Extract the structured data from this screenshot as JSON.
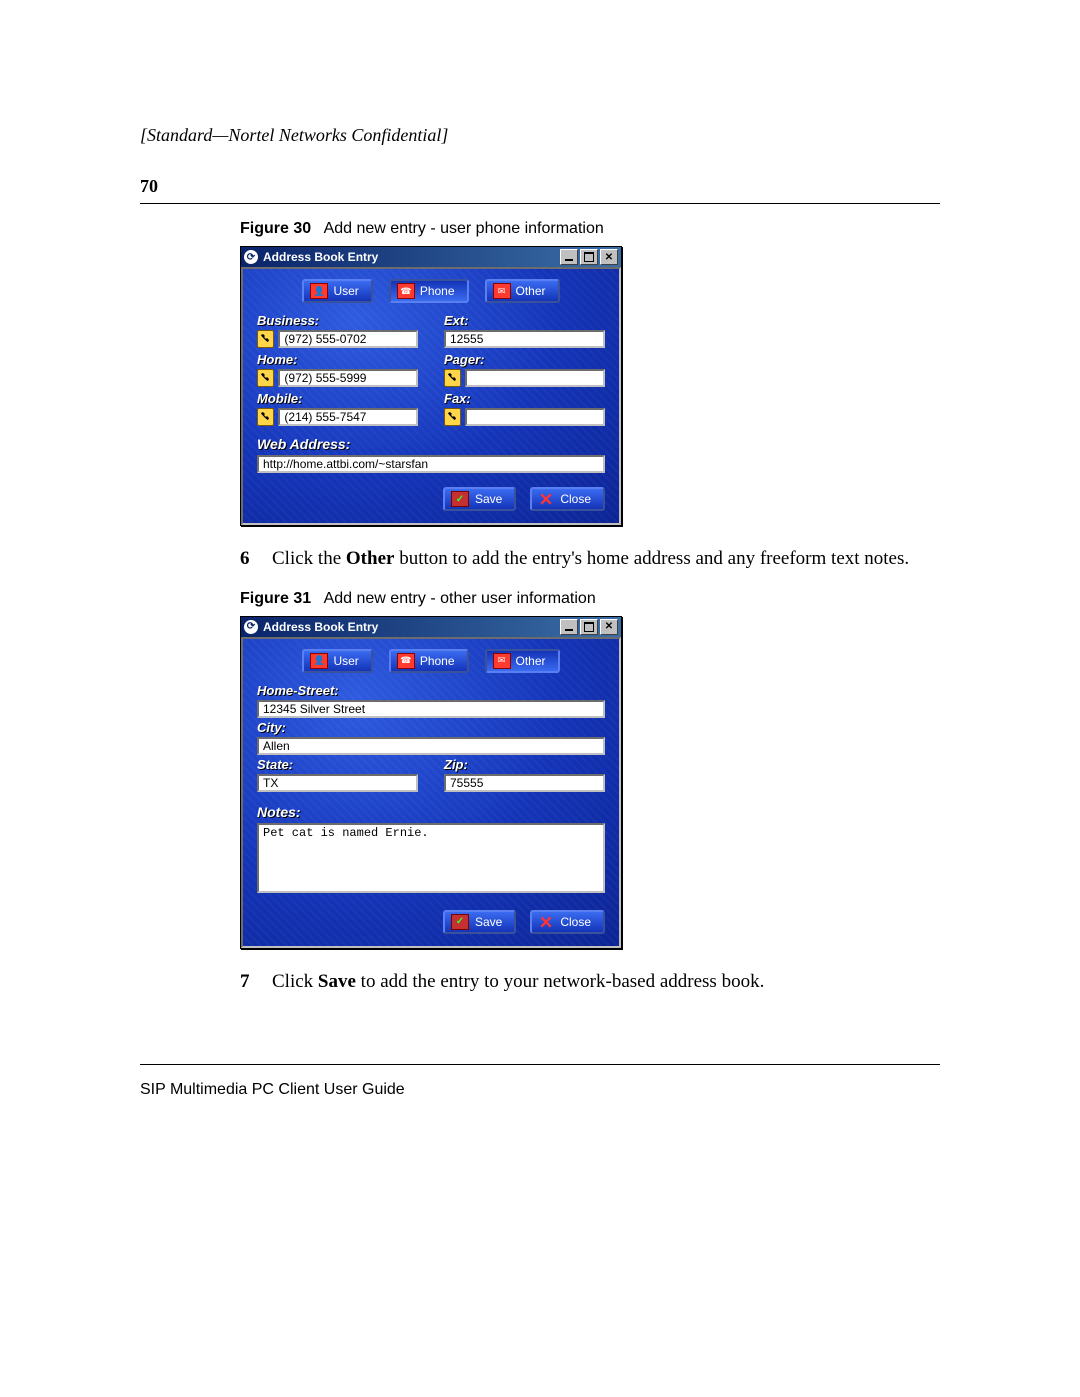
{
  "header": {
    "confidential": "[Standard—Nortel Networks Confidential]",
    "page_number": "70"
  },
  "figure30": {
    "label": "Figure 30",
    "caption": "Add new entry - user phone information",
    "window_title": "Address Book Entry",
    "tabs": {
      "user": "User",
      "phone": "Phone",
      "other": "Other"
    },
    "fields": {
      "business_label": "Business:",
      "business_value": "(972) 555-0702",
      "ext_label": "Ext:",
      "ext_value": "12555",
      "home_label": "Home:",
      "home_value": "(972) 555-5999",
      "pager_label": "Pager:",
      "pager_value": "",
      "mobile_label": "Mobile:",
      "mobile_value": "(214) 555-7547",
      "fax_label": "Fax:",
      "fax_value": "",
      "web_label": "Web Address:",
      "web_value": "http://home.attbi.com/~starsfan"
    },
    "buttons": {
      "save": "Save",
      "close": "Close"
    }
  },
  "step6": {
    "num": "6",
    "text_before": "Click the ",
    "bold": "Other",
    "text_after": " button to add the entry's home address and any freeform text notes."
  },
  "figure31": {
    "label": "Figure 31",
    "caption": "Add new entry - other user information",
    "window_title": "Address Book Entry",
    "tabs": {
      "user": "User",
      "phone": "Phone",
      "other": "Other"
    },
    "fields": {
      "street_label": "Home-Street:",
      "street_value": "12345 Silver Street",
      "city_label": "City:",
      "city_value": "Allen",
      "state_label": "State:",
      "state_value": "TX",
      "zip_label": "Zip:",
      "zip_value": "75555",
      "notes_label": "Notes:",
      "notes_value": "Pet cat is named Ernie."
    },
    "buttons": {
      "save": "Save",
      "close": "Close"
    }
  },
  "step7": {
    "num": "7",
    "text_before": "Click ",
    "bold": "Save",
    "text_after": " to add the entry to your network-based address book."
  },
  "footer": {
    "guide": "SIP Multimedia PC Client User Guide"
  }
}
